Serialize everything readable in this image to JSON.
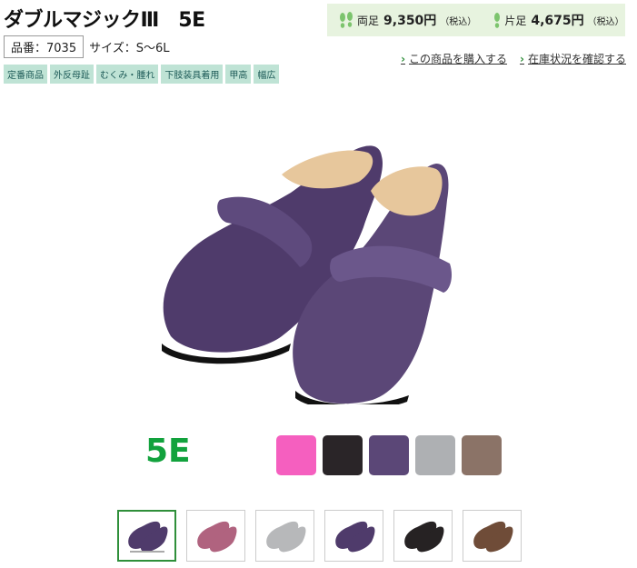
{
  "product": {
    "title": "ダブルマジックⅢ　5E",
    "code_text": "品番：7035",
    "size_text": "サイズ：S〜6L"
  },
  "price": {
    "pair_label": "両足",
    "pair_price": "9,350円",
    "pair_tax": "（税込）",
    "single_label": "片足",
    "single_price": "4,675円",
    "single_tax": "（税込）"
  },
  "links": {
    "buy": "この商品を購入する",
    "stock": "在庫状況を確認する"
  },
  "tags": [
    "定番商品",
    "外反母趾",
    "むくみ・腫れ",
    "下肢装具着用",
    "甲高",
    "幅広"
  ],
  "width_label": "5E",
  "colors": [
    "#f55fbf",
    "#2a2528",
    "#5b4777",
    "#aeb0b3",
    "#8b7367"
  ],
  "thumbnail_colors": [
    "#4f3b6b",
    "#b0637f",
    "#b7b8ba",
    "#4f3b6b",
    "#262223",
    "#6f4c38"
  ],
  "accent": "#12a23d"
}
